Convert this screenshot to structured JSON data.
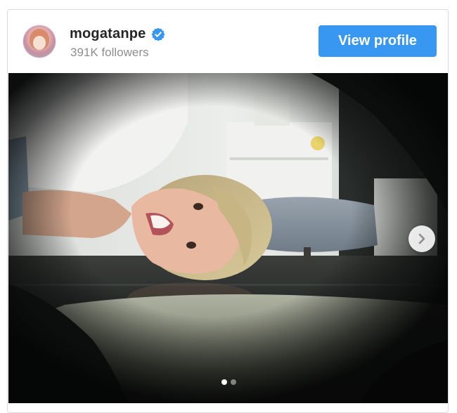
{
  "profile": {
    "username": "mogatanpe",
    "followers": "391K followers",
    "verified": true,
    "avatar_icon": "profile-avatar"
  },
  "actions": {
    "view_profile_label": "View profile"
  },
  "carousel": {
    "next_icon": "chevron-right-icon",
    "slide_count": 2,
    "active_slide": 1
  },
  "colors": {
    "accent": "#3897f0",
    "verified_badge": "#3897f0",
    "followers_text": "#8e8e8e"
  }
}
